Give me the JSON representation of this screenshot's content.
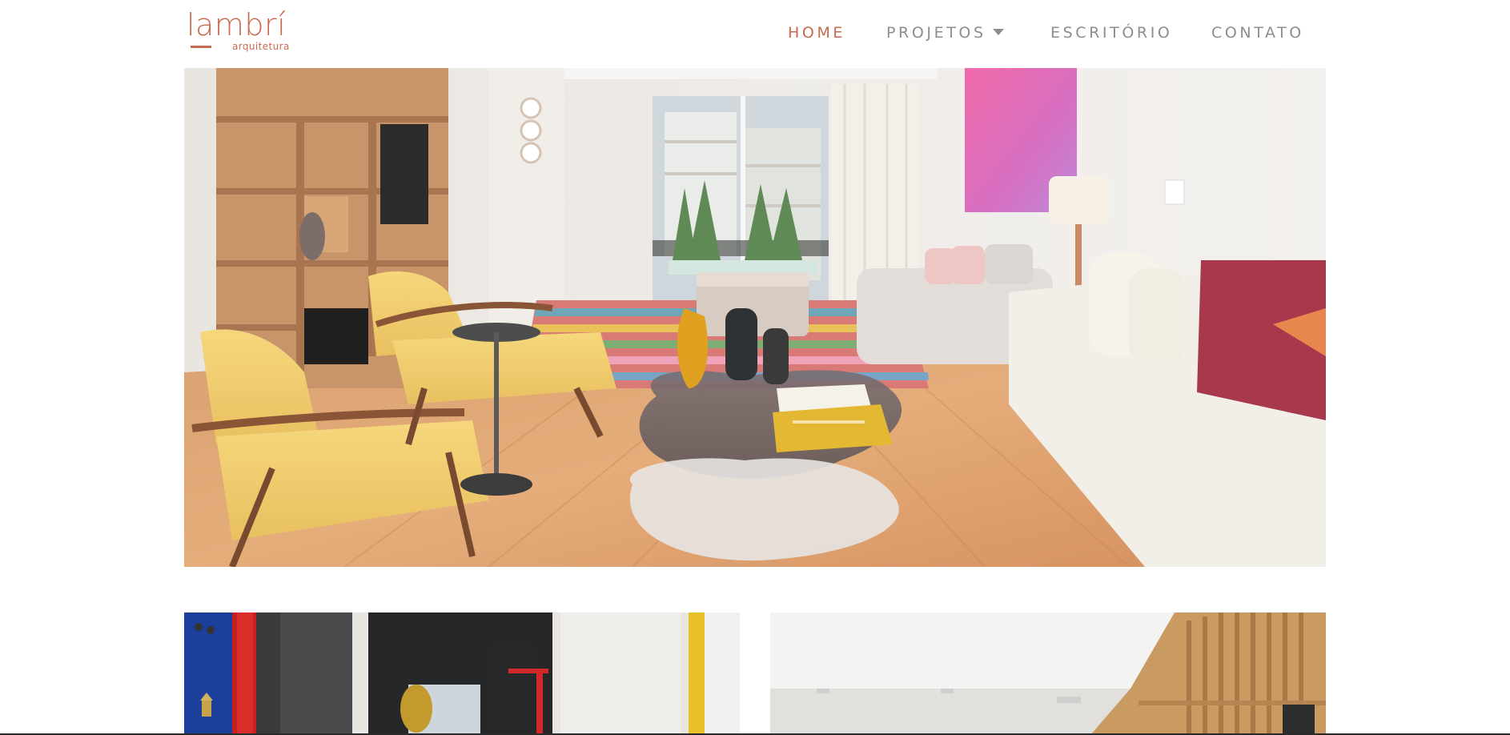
{
  "brand": {
    "logo_name": "lambrí",
    "logo_tagline": "arquitetura",
    "accent_color": "#c96a50",
    "nav_text_color": "#8d8d8d"
  },
  "nav": {
    "items": [
      {
        "label": "HOME",
        "active": true
      },
      {
        "label": "PROJETOS",
        "has_dropdown": true,
        "dropdown_icon": "caret-down-icon"
      },
      {
        "label": "ESCRITÓRIO"
      },
      {
        "label": "CONTATO"
      }
    ]
  },
  "hero": {
    "image": "living-room-photo"
  },
  "projects": {
    "cards": [
      {
        "image": "colorful-interior-photo"
      },
      {
        "image": "wood-slat-interior-photo"
      }
    ]
  }
}
